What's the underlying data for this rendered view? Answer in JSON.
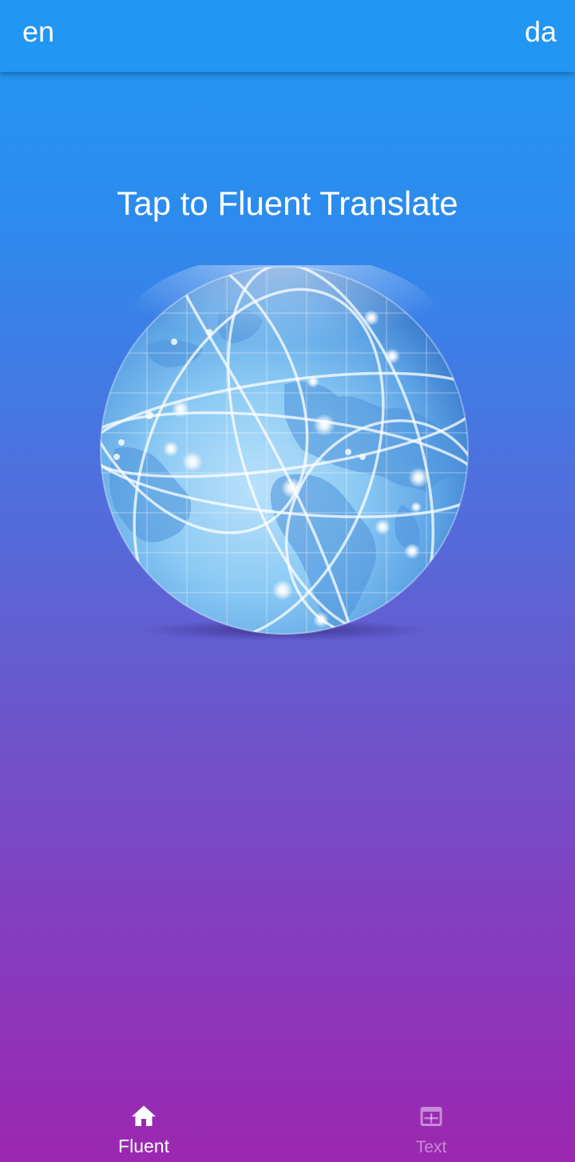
{
  "app_bar": {
    "source_language": "en",
    "target_language": "da"
  },
  "main": {
    "title": "Tap to Fluent Translate",
    "globe_icon": "globe-network-icon"
  },
  "bottom_nav": {
    "items": [
      {
        "label": "Fluent",
        "icon": "home-icon",
        "selected": true
      },
      {
        "label": "Text",
        "icon": "web-asset-icon",
        "selected": false
      }
    ]
  },
  "colors": {
    "app_bar": "#2196f3",
    "gradient_top": "#2196f3",
    "gradient_bottom": "#9c27b0",
    "text_primary": "#ffffff",
    "nav_inactive": "rgba(255,255,255,0.45)"
  }
}
